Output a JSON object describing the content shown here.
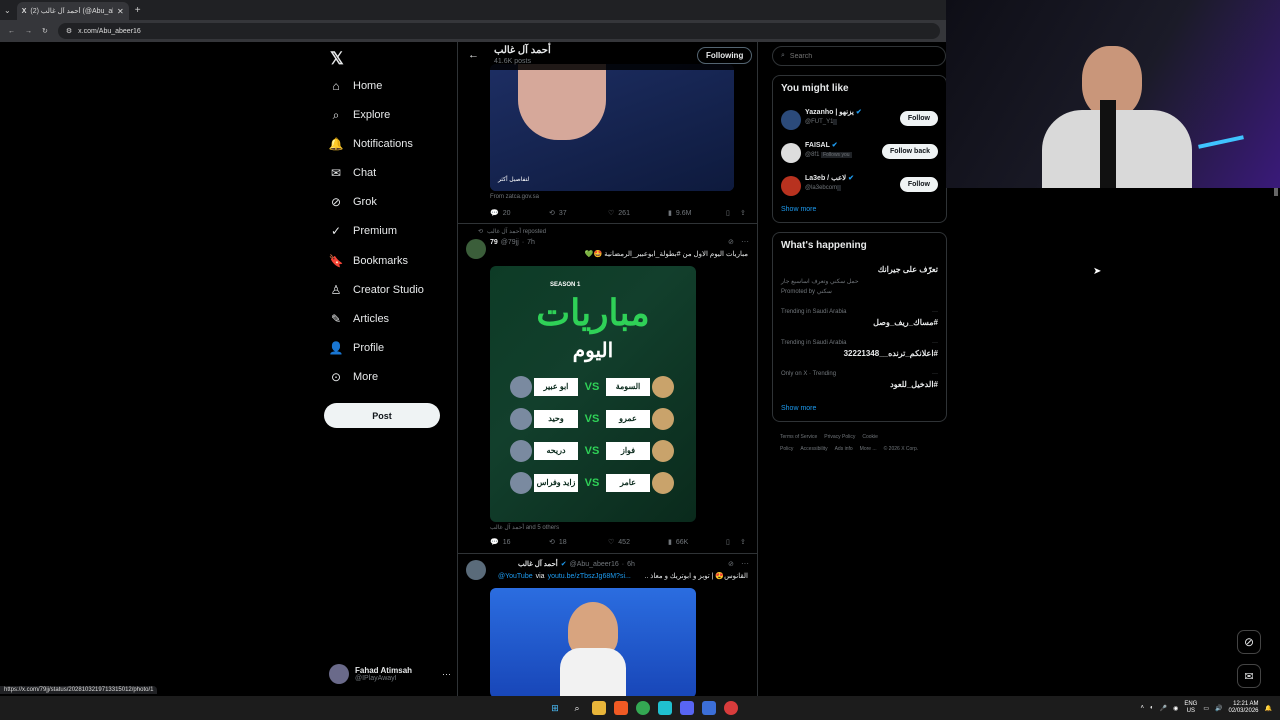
{
  "browser": {
    "tab_title": "(2) أحمد آل غالب (@Abu_abeer16",
    "url": "x.com/Abu_abeer16",
    "status_url": "https://x.com/79jj/status/2028103219713315012/photo/1"
  },
  "nav": {
    "items": [
      {
        "label": "Home",
        "icon": "home-icon"
      },
      {
        "label": "Explore",
        "icon": "search-icon"
      },
      {
        "label": "Notifications",
        "icon": "bell-icon"
      },
      {
        "label": "Chat",
        "icon": "mail-icon"
      },
      {
        "label": "Grok",
        "icon": "grok-icon"
      },
      {
        "label": "Premium",
        "icon": "verified-icon"
      },
      {
        "label": "Bookmarks",
        "icon": "bookmark-icon"
      },
      {
        "label": "Creator Studio",
        "icon": "creator-icon"
      },
      {
        "label": "Articles",
        "icon": "articles-icon"
      },
      {
        "label": "Profile",
        "icon": "profile-icon"
      },
      {
        "label": "More",
        "icon": "more-icon"
      }
    ],
    "post_label": "Post",
    "account": {
      "name": "Fahad Atimsah",
      "handle": "@IPlayAwayI"
    }
  },
  "header": {
    "name": "أحمد آل غالب",
    "posts": "41.6K posts",
    "following_label": "Following"
  },
  "tweet1": {
    "card_caption": "لتفاصيل أكثر",
    "card_caption2": "أكثر",
    "from": "From zatca.gov.sa",
    "replies": "20",
    "reposts": "37",
    "likes": "261",
    "views": "9.6M"
  },
  "tweet2": {
    "repost_label": "أحمد آل غالب reposted",
    "author": "79",
    "handle": "@79jj",
    "time": "7h",
    "text": "مباريات اليوم الاول من #بطولة_ابوعبير_الرمضانية 🤩💚",
    "image_title": "مباريات",
    "image_subtitle": "اليوم",
    "season": "SEASON 1",
    "matches": [
      {
        "left": "ابو عبير",
        "right": "السومة"
      },
      {
        "left": "وحيد",
        "right": "عمرو"
      },
      {
        "left": "دريحه",
        "right": "فواز"
      },
      {
        "left": "زايد وفراس",
        "right": "عامر"
      }
    ],
    "vs": "VS",
    "tagged": "أحمد آل غالب and 5 others",
    "replies": "16",
    "reposts": "18",
    "likes": "452",
    "views": "66K"
  },
  "tweet3": {
    "author": "أحمد آل غالب",
    "handle": "@Abu_abeer16",
    "time": "6h",
    "text_line": "القانوس😍 | توبز و ابوتريك و معاذ ..",
    "link": "youtu.be/zTbszJg68M?si...",
    "via": "via",
    "youtube": "@YouTube"
  },
  "search": {
    "placeholder": "Search"
  },
  "might_like": {
    "title": "You might like",
    "users": [
      {
        "name": "Yazanho | يزنهو",
        "handle": "@FUT_Y1",
        "button": "Follow",
        "follows_you": ""
      },
      {
        "name": "FAISAL",
        "handle": "@8f1",
        "button": "Follow back",
        "follows_you": "Follows you"
      },
      {
        "name": "La3eb / لاعب",
        "handle": "@la3ebcom",
        "button": "Follow",
        "follows_you": ""
      }
    ],
    "show_more": "Show more"
  },
  "happening": {
    "title": "What's happening",
    "promo_title": "تعرّف على جيرانك",
    "promo_desc": "حمل سكني وتعرف اساسيع جار",
    "promo_by": "Promoted by سكني",
    "trends": [
      {
        "context": "Trending in Saudi Arabia",
        "tag": "#مساك_ريف_وصل"
      },
      {
        "context": "Trending in Saudi Arabia",
        "tag": "#اعلانكم_ترنده__32221348"
      },
      {
        "context": "Only on X · Trending",
        "tag": "#الدخيل_للعود"
      }
    ],
    "show_more": "Show more"
  },
  "footer_links": [
    "Terms of Service",
    "Privacy Policy",
    "Cookie Policy",
    "Accessibility",
    "Ads info",
    "More ...",
    "© 2026 X Corp."
  ],
  "taskbar": {
    "lang1": "ENG",
    "lang2": "US",
    "time": "12:21 AM",
    "date": "02/03/2026"
  },
  "colors": {
    "accent": "#1d9bf0",
    "green": "#2fd157",
    "bg": "#000000"
  }
}
